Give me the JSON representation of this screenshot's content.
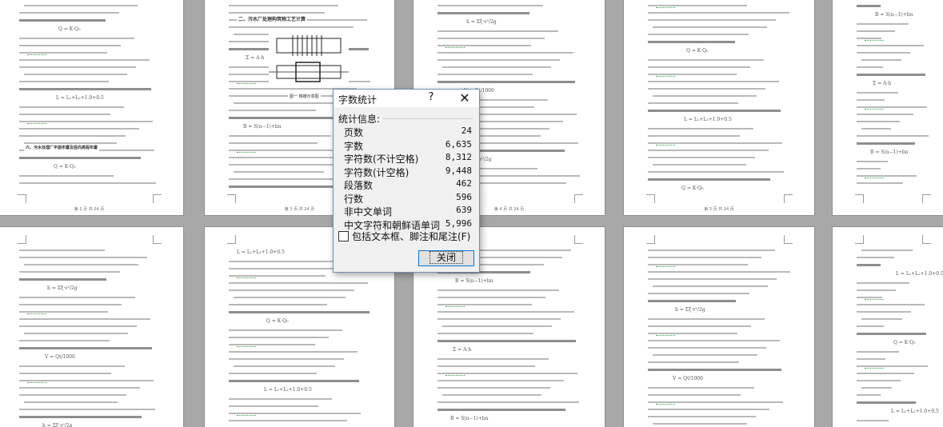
{
  "dialog": {
    "title": "字数统计",
    "help_glyph": "?",
    "close_glyph": "✕",
    "section_label": "统计信息:",
    "stats": [
      {
        "label": "页数",
        "value": "24"
      },
      {
        "label": "字数",
        "value": "6,635"
      },
      {
        "label": "字符数(不计空格)",
        "value": "8,312"
      },
      {
        "label": "字符数(计空格)",
        "value": "9,448"
      },
      {
        "label": "段落数",
        "value": "462"
      },
      {
        "label": "行数",
        "value": "596"
      },
      {
        "label": "非中文单词",
        "value": "639"
      },
      {
        "label": "中文字符和朝鲜语单词",
        "value": "5,996"
      }
    ],
    "include_checkbox_label": "包括文本框、脚注和尾注(F)",
    "include_checked": false,
    "close_button_label": "关闭"
  },
  "pages": {
    "p2_heading": "二、污水厂处理构筑物工艺计算",
    "p1_heading": "六、污水处理厂平面布置及竖向高程布置",
    "p2_caption": "图一  格栅示意图",
    "p_numbers": [
      "第 2 页 共 24 页",
      "第 3 页 共 24 页",
      "第 4 页 共 24 页",
      "第 5 页 共 24 页"
    ]
  },
  "colors": {
    "background": "#a8a8a8",
    "page": "#ffffff",
    "dialog_border": "#6f8fb4",
    "button_focus": "#0078d7",
    "squiggle": "#3aa34a"
  }
}
